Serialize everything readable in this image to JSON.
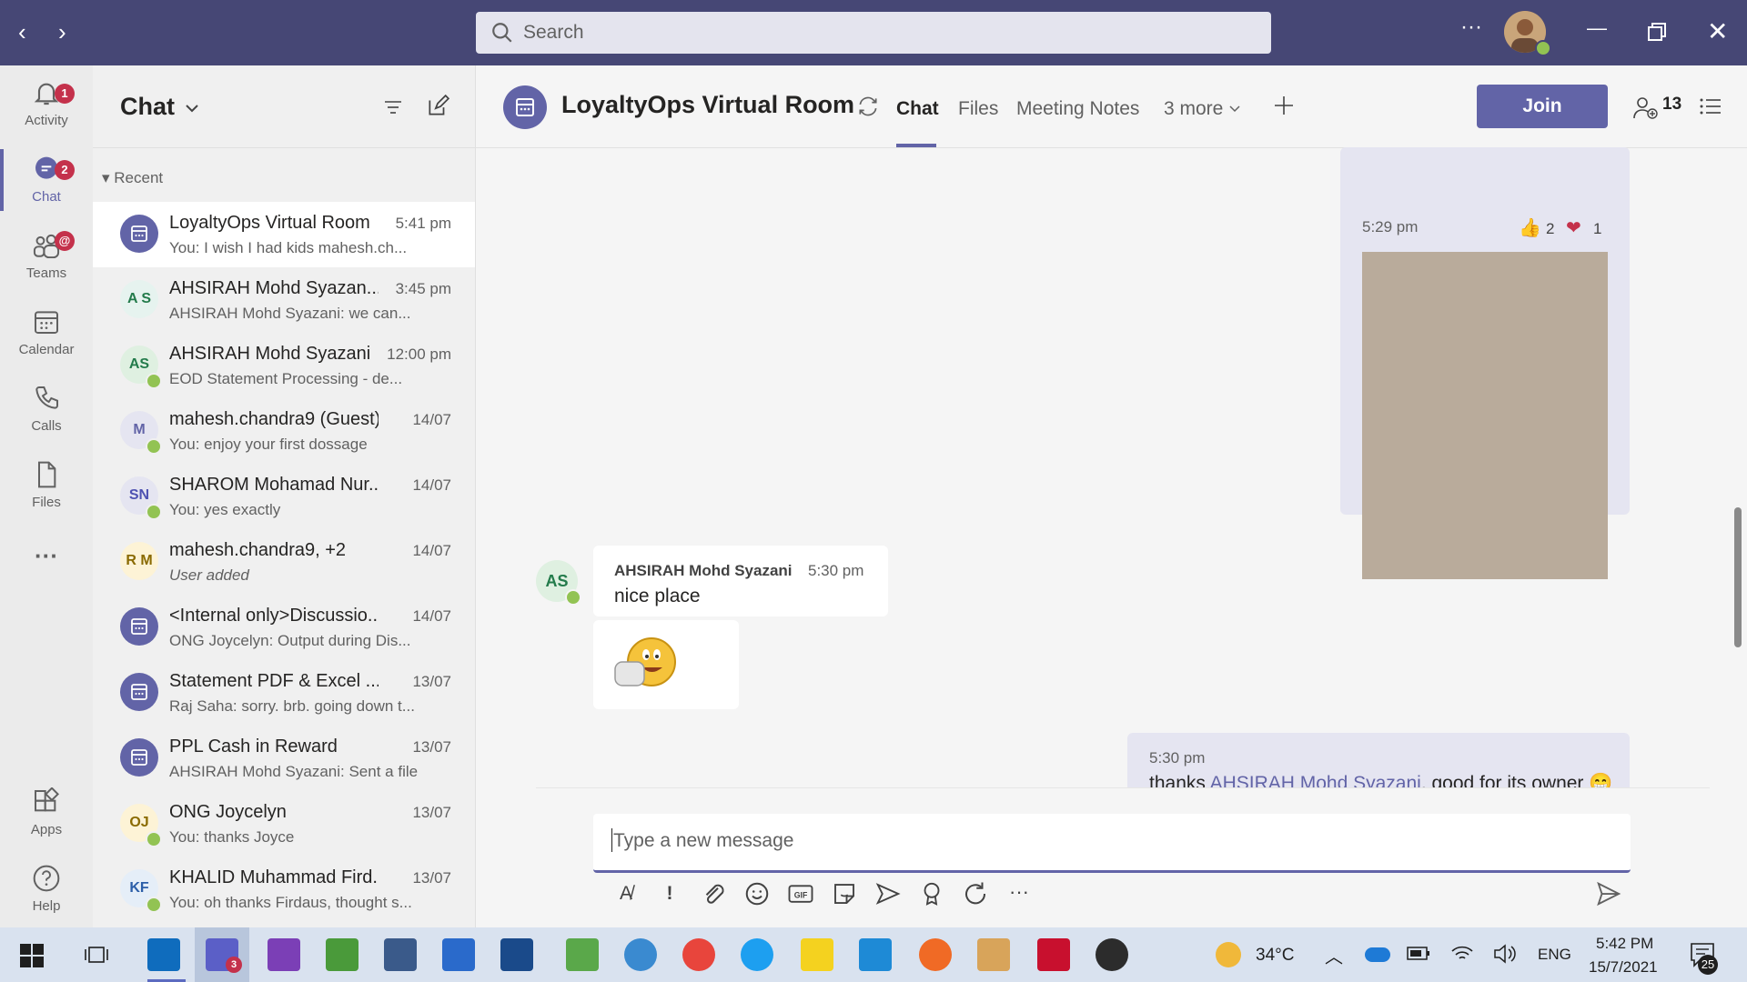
{
  "topbar": {
    "search_placeholder": "Search",
    "more_label": "···",
    "colors": {
      "bar": "#464775",
      "accent": "#6264a7"
    }
  },
  "rail": {
    "items": [
      {
        "label": "Activity",
        "icon": "bell-icon",
        "badge": "1"
      },
      {
        "label": "Chat",
        "icon": "chat-icon",
        "badge": "2"
      },
      {
        "label": "Teams",
        "icon": "teams-icon",
        "badge": "@"
      },
      {
        "label": "Calendar",
        "icon": "calendar-icon"
      },
      {
        "label": "Calls",
        "icon": "phone-icon"
      },
      {
        "label": "Files",
        "icon": "file-icon"
      },
      {
        "label": "···",
        "icon": "more-icon"
      },
      {
        "label": "Apps",
        "icon": "apps-icon"
      },
      {
        "label": "Help",
        "icon": "help-icon"
      }
    ]
  },
  "chatlist": {
    "title": "Chat",
    "section": "Recent",
    "items": [
      {
        "name": "LoyaltyOps Virtual Room",
        "time": "5:41 pm",
        "preview": "You: I wish I had kids mahesh.ch...",
        "avatar": "meeting"
      },
      {
        "name": "AHSIRAH Mohd Syazan...",
        "time": "3:45 pm",
        "preview": "AHSIRAH Mohd Syazani: we can...",
        "avatar": "A S"
      },
      {
        "name": "AHSIRAH Mohd Syazani",
        "time": "12:00 pm",
        "preview": "EOD Statement Processing - de...",
        "avatar": "AS"
      },
      {
        "name": "mahesh.chandra9 (Guest)",
        "time": "14/07",
        "preview": "You: enjoy your first dossage",
        "avatar": "M"
      },
      {
        "name": "SHAROM Mohamad Nur...",
        "time": "14/07",
        "preview": "You: yes exactly",
        "avatar": "SN"
      },
      {
        "name": "mahesh.chandra9, +2",
        "time": "14/07",
        "preview": "User added",
        "avatar": "R M"
      },
      {
        "name": "<Internal only>Discussio...",
        "time": "14/07",
        "preview": "ONG Joycelyn: Output during Dis...",
        "avatar": "meeting"
      },
      {
        "name": "Statement PDF & Excel ...",
        "time": "13/07",
        "preview": "Raj Saha: sorry. brb. going down t...",
        "avatar": "meeting"
      },
      {
        "name": "PPL Cash in Reward",
        "time": "13/07",
        "preview": "AHSIRAH Mohd Syazani: Sent a file",
        "avatar": "meeting"
      },
      {
        "name": "ONG Joycelyn",
        "time": "13/07",
        "preview": "You: thanks Joyce",
        "avatar": "OJ"
      },
      {
        "name": "KHALID Muhammad Fird...",
        "time": "13/07",
        "preview": "You: oh thanks Firdaus, thought s...",
        "avatar": "KF"
      }
    ]
  },
  "header": {
    "room_title": "LoyaltyOps Virtual Room",
    "tabs": [
      "Chat",
      "Files",
      "Meeting Notes",
      "3 more"
    ],
    "join_label": "Join",
    "participants_count": "13"
  },
  "messages": {
    "m1": {
      "time": "5:29 pm",
      "like_count": "2",
      "heart_count": "1"
    },
    "m2": {
      "author": "AHSIRAH Mohd Syazani",
      "time": "5:30 pm",
      "text": "nice place",
      "avatar": "AS"
    },
    "m3": {
      "time": "5:30 pm",
      "text_prefix": "thanks ",
      "mention": "AHSIRAH Mohd Syazani",
      "text_suffix": ", good for its owner"
    }
  },
  "compose": {
    "placeholder": "Type a new message"
  },
  "taskbar": {
    "weather": "34°C",
    "lang": "ENG",
    "time": "5:42 PM",
    "date": "15/7/2021",
    "notif_count": "25",
    "teams_badge": "3"
  }
}
